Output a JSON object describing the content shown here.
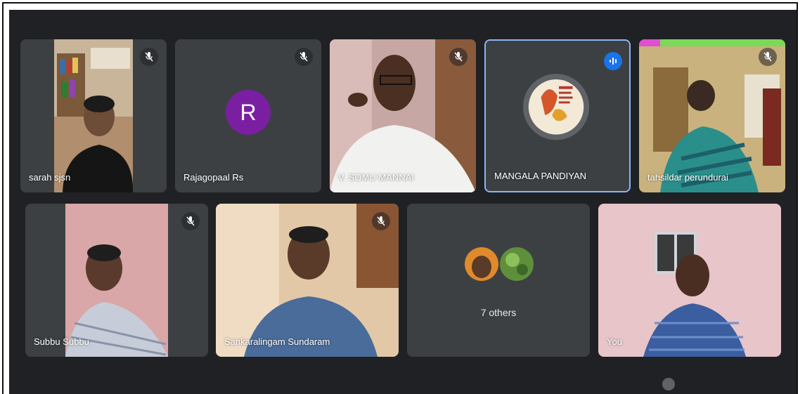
{
  "participants": [
    {
      "name": "sarah sjsn",
      "muted": true
    },
    {
      "name": "Rajagopaal Rs",
      "muted": true,
      "avatar_letter": "R",
      "avatar_color": "#7b1fa2"
    },
    {
      "name": "V. SOMU MANNAI",
      "muted": true
    },
    {
      "name": "MANGALA PANDIYAN",
      "speaking": true
    },
    {
      "name": "tahsildar perundurai",
      "muted": true
    },
    {
      "name": "Subbu Subbu",
      "muted": true
    },
    {
      "name": "Sankaralingam Sundaram",
      "muted": true
    },
    {
      "name": "7 others"
    },
    {
      "name": "You"
    }
  ],
  "colors": {
    "background": "#202124",
    "tile": "#3c4043",
    "active_border": "#8ab4f8",
    "speaking_badge": "#1a73e8"
  },
  "icons": [
    "mic-off-icon",
    "speaking-indicator-icon"
  ]
}
